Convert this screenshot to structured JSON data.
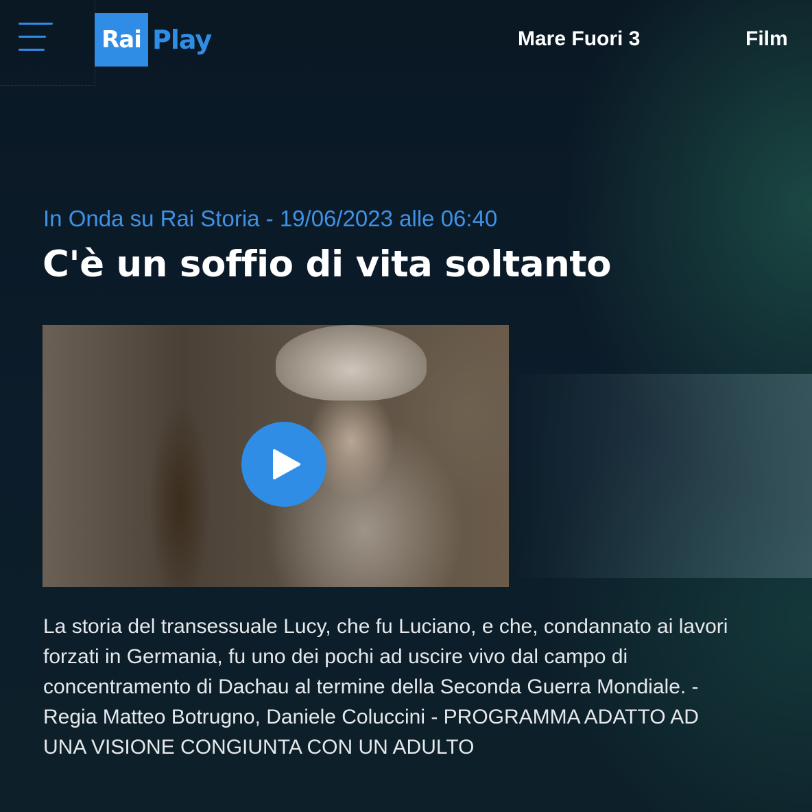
{
  "header": {
    "menu_icon": "hamburger-menu-icon",
    "logo": {
      "part1": "Rai",
      "part2": "Play"
    },
    "nav": [
      {
        "label": "Mare Fuori 3"
      },
      {
        "label": "Film"
      }
    ]
  },
  "program": {
    "airing": "In Onda su Rai Storia - 19/06/2023 alle 06:40",
    "title": "C'è un soffio di vita soltanto",
    "video": {
      "play_icon": "play-icon"
    },
    "description": "La storia del transessuale Lucy, che fu Luciano, e che, condannato ai lavori forzati in Germania, fu uno dei pochi ad uscire vivo dal campo di concentramento di Dachau al termine della Seconda Guerra Mondiale. - Regia Matteo Botrugno, Daniele Coluccini - PROGRAMMA ADATTO AD UNA VISIONE CONGIUNTA CON UN ADULTO"
  },
  "colors": {
    "accent": "#2f8de6",
    "airing_text": "#3f92e6",
    "background": "#0b1a27"
  }
}
